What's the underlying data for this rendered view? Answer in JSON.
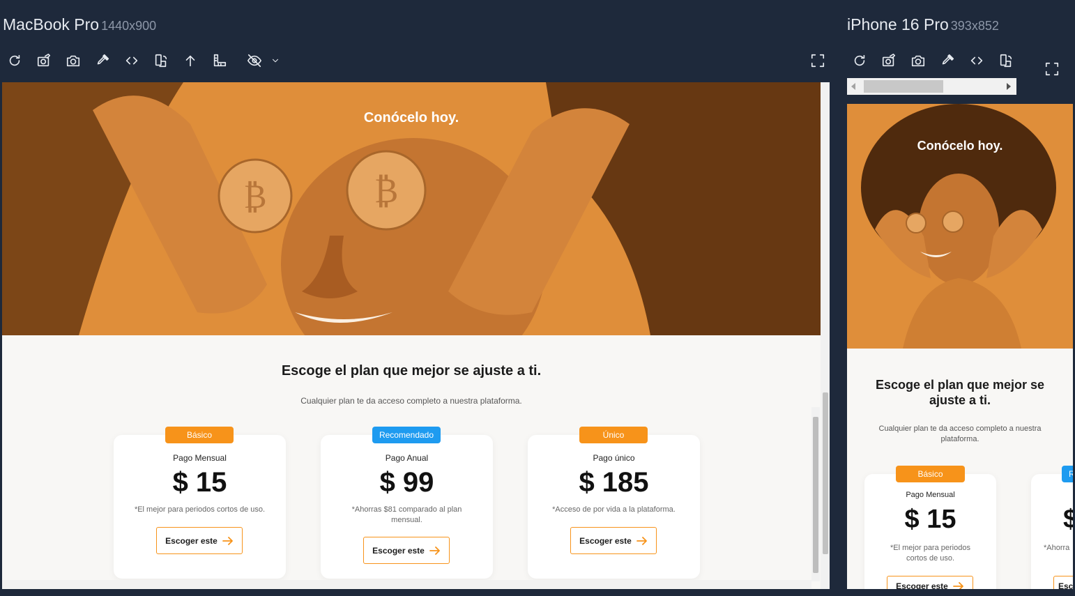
{
  "devices": {
    "macbook": {
      "name": "MacBook Pro",
      "dims": "1440x900"
    },
    "iphone": {
      "name": "iPhone 16 Pro",
      "dims": "393x852"
    }
  },
  "toolbar_icons": [
    "refresh-icon",
    "camera-edit-icon",
    "camera-icon",
    "eyedropper-icon",
    "code-icon",
    "device-rotate-icon",
    "arrow-up-icon",
    "ruler-icon",
    "eye-off-icon",
    "chevron-down-icon"
  ],
  "colors": {
    "brand_orange": "#f7931a",
    "recommended_blue": "#1e9bf0",
    "chrome_bg": "#1e293b",
    "page_bg": "#f8f7f5"
  },
  "page": {
    "hero_title": "Conócelo hoy.",
    "plans_title": "Escoge el plan que mejor se ajuste a ti.",
    "plans_subtitle": "Cualquier plan te da acceso completo a nuestra plataforma.",
    "plans": [
      {
        "badge": "Básico",
        "name": "Pago Mensual",
        "price": "$ 15",
        "note": "*El mejor para periodos cortos de uso.",
        "cta": "Escoger este"
      },
      {
        "badge": "Recomendado",
        "name": "Pago Anual",
        "price": "$ 99",
        "note": "*Ahorras $81 comparado al plan mensual.",
        "cta": "Escoger este"
      },
      {
        "badge": "Único",
        "name": "Pago único",
        "price": "$ 185",
        "note": "*Acceso de por vida a la plataforma.",
        "cta": "Escoger este"
      }
    ],
    "mobile_cta_partial": "Escoger este",
    "mobile_badge_partial": "R",
    "mobile_price_partial": "$",
    "mobile_note_partial": "*Ahorra"
  }
}
